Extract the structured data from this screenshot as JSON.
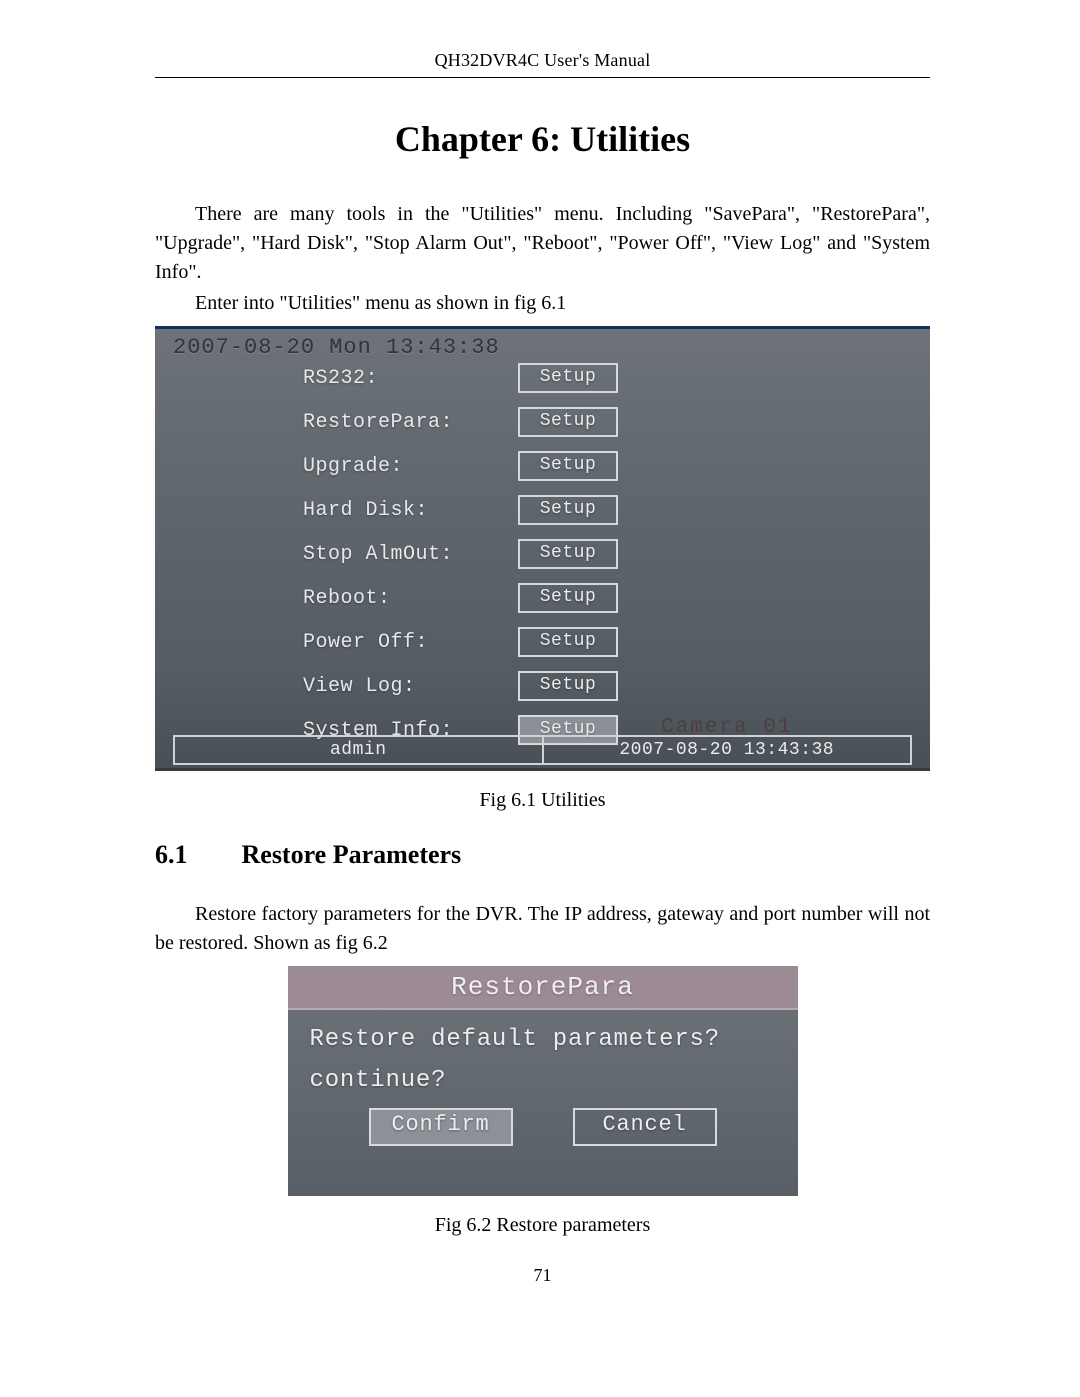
{
  "running_head": "QH32DVR4C User's Manual",
  "chapter_title": "Chapter 6: Utilities",
  "intro_para": "There are many tools in the \"Utilities\" menu. Including \"SavePara\", \"RestorePara\", \"Upgrade\", \"Hard Disk\", \"Stop Alarm Out\", \"Reboot\", \"Power Off\", \"View Log\" and \"System Info\".",
  "intro_line2": "Enter into \"Utilities\" menu as shown in fig 6.1",
  "dvr": {
    "datetime": "2007-08-20 Mon 13:43:38",
    "rows": [
      {
        "label": "RS232:",
        "button": "Setup",
        "selected": false
      },
      {
        "label": "RestorePara:",
        "button": "Setup",
        "selected": false
      },
      {
        "label": "Upgrade:",
        "button": "Setup",
        "selected": false
      },
      {
        "label": "Hard Disk:",
        "button": "Setup",
        "selected": false
      },
      {
        "label": "Stop AlmOut:",
        "button": "Setup",
        "selected": false
      },
      {
        "label": "Reboot:",
        "button": "Setup",
        "selected": false
      },
      {
        "label": "Power Off:",
        "button": "Setup",
        "selected": false
      },
      {
        "label": "View Log:",
        "button": "Setup",
        "selected": false
      },
      {
        "label": "System Info:",
        "button": "Setup",
        "selected": true
      }
    ],
    "status_left": "admin",
    "status_camera": "Camera 01",
    "status_right": "2007-08-20 13:43:38"
  },
  "fig61_caption": "Fig 6.1 Utilities",
  "section61_num": "6.1",
  "section61_title": "Restore Parameters",
  "section61_para": "Restore factory parameters for the DVR. The IP address, gateway and port number will not be restored. Shown as fig 6.2",
  "restore": {
    "title": "RestorePara",
    "line1": "Restore default parameters?",
    "line2": "continue?",
    "confirm": "Confirm",
    "cancel": "Cancel"
  },
  "fig62_caption": "Fig 6.2 Restore parameters",
  "page_number": "71"
}
